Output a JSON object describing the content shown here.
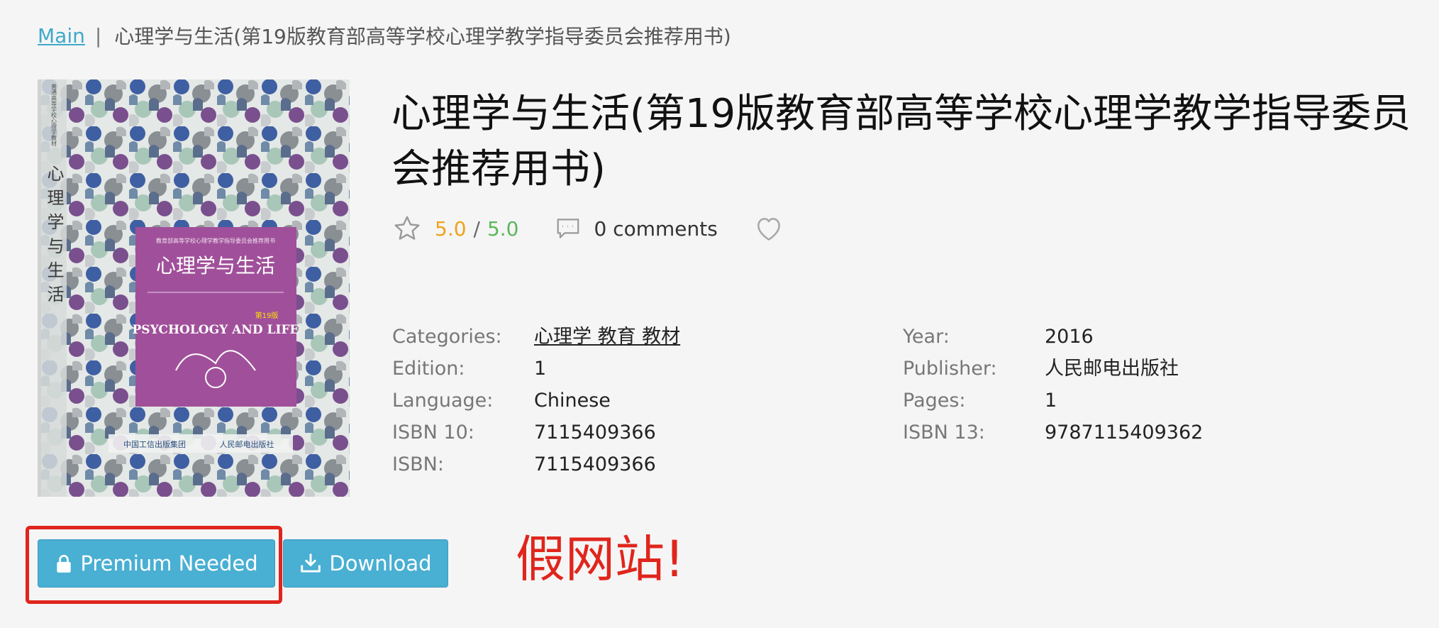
{
  "breadcrumb": {
    "home": "Main",
    "separator": "|",
    "current": "心理学与生活(第19版教育部高等学校心理学教学指导委员会推荐用书)"
  },
  "cover": {
    "series_top": "普通高等学校心理学教材",
    "spine_title": "心理学与生活",
    "recommend": "教育部高等学校心理学教学指导委员会推荐用书",
    "cn_title": "心理学与生活",
    "en_title": "PSYCHOLOGY AND LIFE",
    "edition_badge": "第19版",
    "publisher_logo": "人民邮电出版社",
    "group_logo": "中国工信出版集团"
  },
  "book": {
    "title": "心理学与生活(第19版教育部高等学校心理学教学指导委员会推荐用书)",
    "rating": "5.0",
    "rating_sep": "/",
    "rating_max": "5.0",
    "comments": "0 comments"
  },
  "details_left": [
    {
      "label": "Categories:",
      "value": "心理学 教育 教材",
      "link": true
    },
    {
      "label": "Edition:",
      "value": "1"
    },
    {
      "label": "Language:",
      "value": "Chinese"
    },
    {
      "label": "ISBN 10:",
      "value": "7115409366"
    },
    {
      "label": "ISBN:",
      "value": "7115409366"
    }
  ],
  "details_right": [
    {
      "label": "Year:",
      "value": "2016"
    },
    {
      "label": "Publisher:",
      "value": "人民邮电出版社"
    },
    {
      "label": "Pages:",
      "value": "1"
    },
    {
      "label": "ISBN 13:",
      "value": "9787115409362"
    }
  ],
  "buttons": {
    "premium": "Premium Needed",
    "download": "Download"
  },
  "annotation": "假网站!",
  "colors": {
    "accent": "#49afd3",
    "link": "#3fa9c9",
    "rating": "#f0a21b",
    "rating_max": "#5bb75b",
    "warning": "#e0251c",
    "cover_panel": "#a0509a"
  }
}
